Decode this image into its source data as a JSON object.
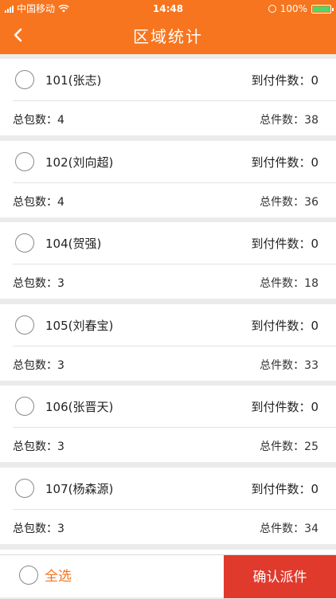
{
  "status_bar": {
    "carrier": "中国移动",
    "time": "14:48",
    "battery_percent": "100%",
    "battery_level": 1.0
  },
  "nav": {
    "title": "区域统计",
    "back_icon": "chevron-left-icon"
  },
  "colors": {
    "brand": "#f7751e",
    "confirm": "#e03a2d"
  },
  "labels": {
    "arrival": "到付件数：",
    "packages": "总包数：",
    "total": "总件数："
  },
  "items": [
    {
      "name": "101(张志)",
      "arrival": "0",
      "packages": "4",
      "total": "38"
    },
    {
      "name": "102(刘向超)",
      "arrival": "0",
      "packages": "4",
      "total": "36"
    },
    {
      "name": "104(贺强)",
      "arrival": "0",
      "packages": "3",
      "total": "18"
    },
    {
      "name": "105(刘春宝)",
      "arrival": "0",
      "packages": "3",
      "total": "33"
    },
    {
      "name": "106(张晋天)",
      "arrival": "0",
      "packages": "3",
      "total": "25"
    },
    {
      "name": "107(杨森源)",
      "arrival": "0",
      "packages": "3",
      "total": "34"
    }
  ],
  "bottom": {
    "select_all": "全选",
    "confirm": "确认派件"
  }
}
